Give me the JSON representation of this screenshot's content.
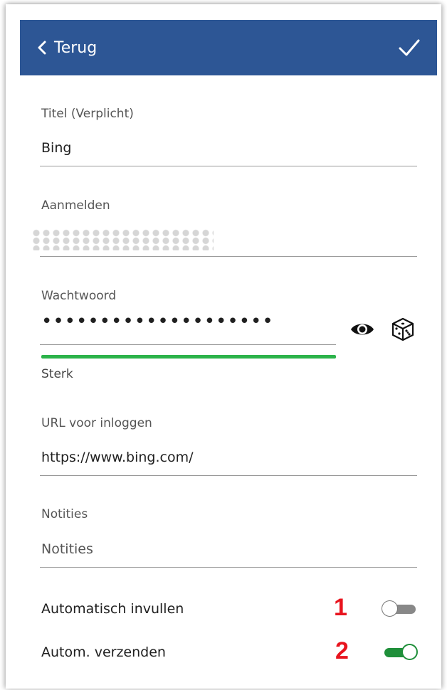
{
  "header": {
    "back_label": "Terug",
    "back_icon": "chevron-left-icon",
    "save_icon": "checkmark-icon"
  },
  "fields": {
    "title_label": "Titel (Verplicht)",
    "title_value": "Bing",
    "login_label": "Aanmelden",
    "password_label": "Wachtwoord",
    "password_value": "••••••••••••••••••••",
    "password_strength": "Sterk",
    "password_strength_level": 1.0,
    "url_label": "URL voor inloggen",
    "url_value": "https://www.bing.com/",
    "notes_label": "Notities",
    "notes_placeholder": "Notities"
  },
  "toggles": {
    "autofill_label": "Automatisch invullen",
    "autofill_on": false,
    "autosubmit_label": "Autom. verzenden",
    "autosubmit_on": true
  },
  "annotations": {
    "marker_1": "1",
    "marker_2": "2"
  },
  "colors": {
    "header": "#2d5695",
    "strength_bar": "#2cb34a",
    "toggle_on": "#1f8f3a",
    "toggle_off": "#888888",
    "marker": "#e8141e"
  }
}
